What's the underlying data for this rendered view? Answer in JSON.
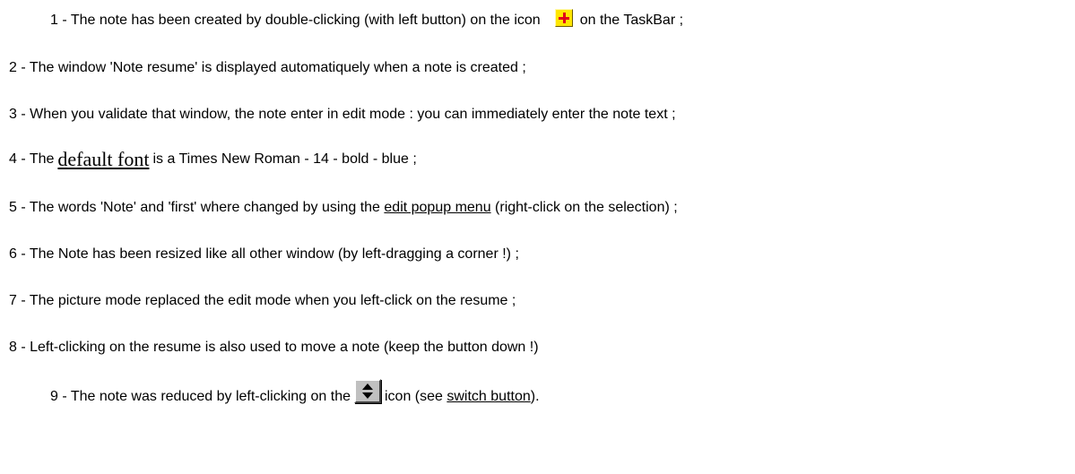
{
  "lines": {
    "l1": {
      "before": "1 - The note has been created by double-clicking (with left button) on the icon",
      "icon": "taskbar-add-icon",
      "after": "on the TaskBar ;"
    },
    "l2": {
      "text": "2 - The window 'Note resume' is displayed automatiquely when a note is created ;"
    },
    "l3": {
      "text": "3 - When you validate that window, the note enter in edit mode : you can immediately enter the note text ;"
    },
    "l4": {
      "before": "4 - The",
      "link": "default font",
      "after": "is a Times New Roman - 14 - bold - blue ;"
    },
    "l5": {
      "before": "5 - The words 'Note' and 'first' where changed by using the",
      "link": "edit popup menu",
      "after": "(right-click on the selection) ;"
    },
    "l6": {
      "text": "6 - The Note has been resized like all other window (by left-dragging a corner !) ;"
    },
    "l7": {
      "text": "7 - The picture mode replaced the edit mode when you left-click on the resume ;"
    },
    "l8": {
      "text": "8 - Left-clicking on the resume is also used to move a note (keep the button down !)"
    },
    "l9": {
      "before": "9 - The note was reduced by left-clicking on the",
      "icon": "switch-button-icon",
      "middle": "icon (see",
      "link": "switch button",
      "after": ")."
    }
  },
  "colors": {
    "text": "#000000",
    "background": "#ffffff",
    "plus_icon_fill": "#ffe600",
    "plus_icon_cross": "#e0001a",
    "switch_icon_face": "#c0c0c0"
  }
}
